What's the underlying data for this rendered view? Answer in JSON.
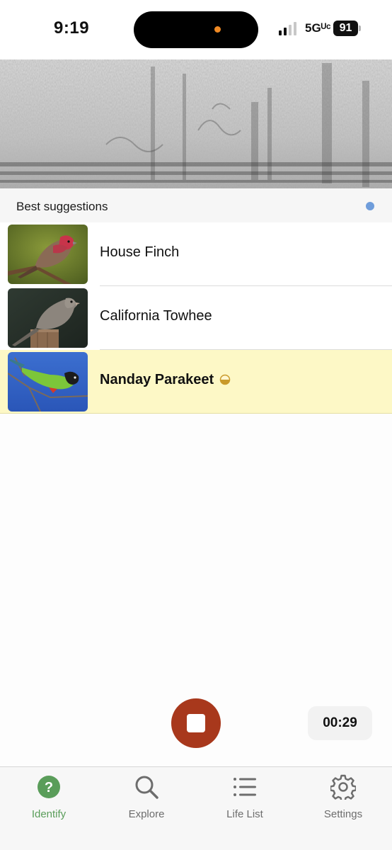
{
  "status_bar": {
    "time": "9:19",
    "network": "5Gᵁᶜ",
    "battery": "91"
  },
  "suggestions": {
    "title": "Best suggestions",
    "indicator_color": "#6f9ddb",
    "items": [
      {
        "name": "House Finch",
        "highlighted": false,
        "rare": false
      },
      {
        "name": "California Towhee",
        "highlighted": false,
        "rare": false
      },
      {
        "name": "Nanday Parakeet",
        "highlighted": true,
        "rare": true,
        "rare_icon": "half-circle-icon"
      }
    ]
  },
  "recording": {
    "timer": "00:29",
    "button_color": "#a8381c"
  },
  "tab_bar": {
    "active": "Identify",
    "accent_color": "#5a9d5a",
    "tabs": [
      {
        "label": "Identify",
        "icon": "question-circle-icon"
      },
      {
        "label": "Explore",
        "icon": "search-icon"
      },
      {
        "label": "Life List",
        "icon": "list-icon"
      },
      {
        "label": "Settings",
        "icon": "gear-icon"
      }
    ]
  }
}
